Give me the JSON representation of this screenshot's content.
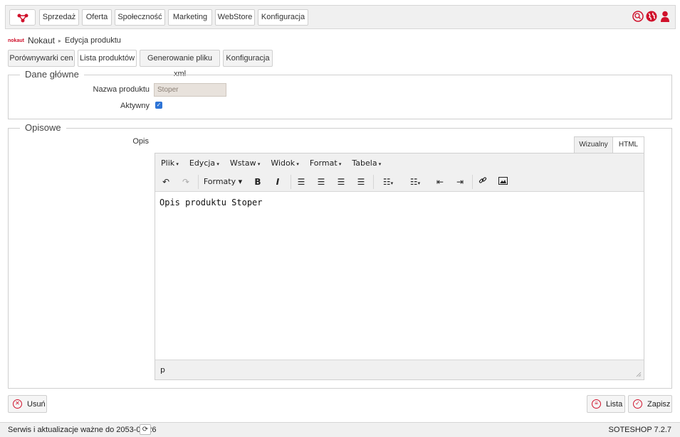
{
  "nav": {
    "items": [
      "Sprzedaż",
      "Oferta",
      "Społeczność",
      "Marketing",
      "WebStore",
      "Konfiguracja"
    ]
  },
  "breadcrumb": {
    "brand": "nokaut",
    "module": "Nokaut",
    "separator": "▸",
    "page": "Edycja produktu"
  },
  "tabs": [
    "Porównywarki cen",
    "Lista produktów",
    "Generowanie pliku xml",
    "Konfiguracja"
  ],
  "sections": {
    "main": {
      "legend": "Dane główne",
      "name_label": "Nazwa produktu",
      "name_value": "Stoper",
      "active_label": "Aktywny",
      "active_checked": true
    },
    "desc": {
      "legend": "Opisowe",
      "label": "Opis"
    }
  },
  "editor": {
    "mode_tabs": [
      "Wizualny",
      "HTML"
    ],
    "menu": [
      "Plik",
      "Edycja",
      "Wstaw",
      "Widok",
      "Format",
      "Tabela"
    ],
    "formats_label": "Formaty",
    "bold": "B",
    "italic": "I",
    "content": "Opis produktu Stoper",
    "path": "p"
  },
  "actions": {
    "delete": "Usuń",
    "list": "Lista",
    "save": "Zapisz"
  },
  "footer": {
    "license": "Serwis i aktualizacje ważne do 2053-08-26",
    "version": "SOTESHOP 7.2.7"
  },
  "colors": {
    "accent": "#d0112b",
    "checkbox": "#2e74d6"
  }
}
